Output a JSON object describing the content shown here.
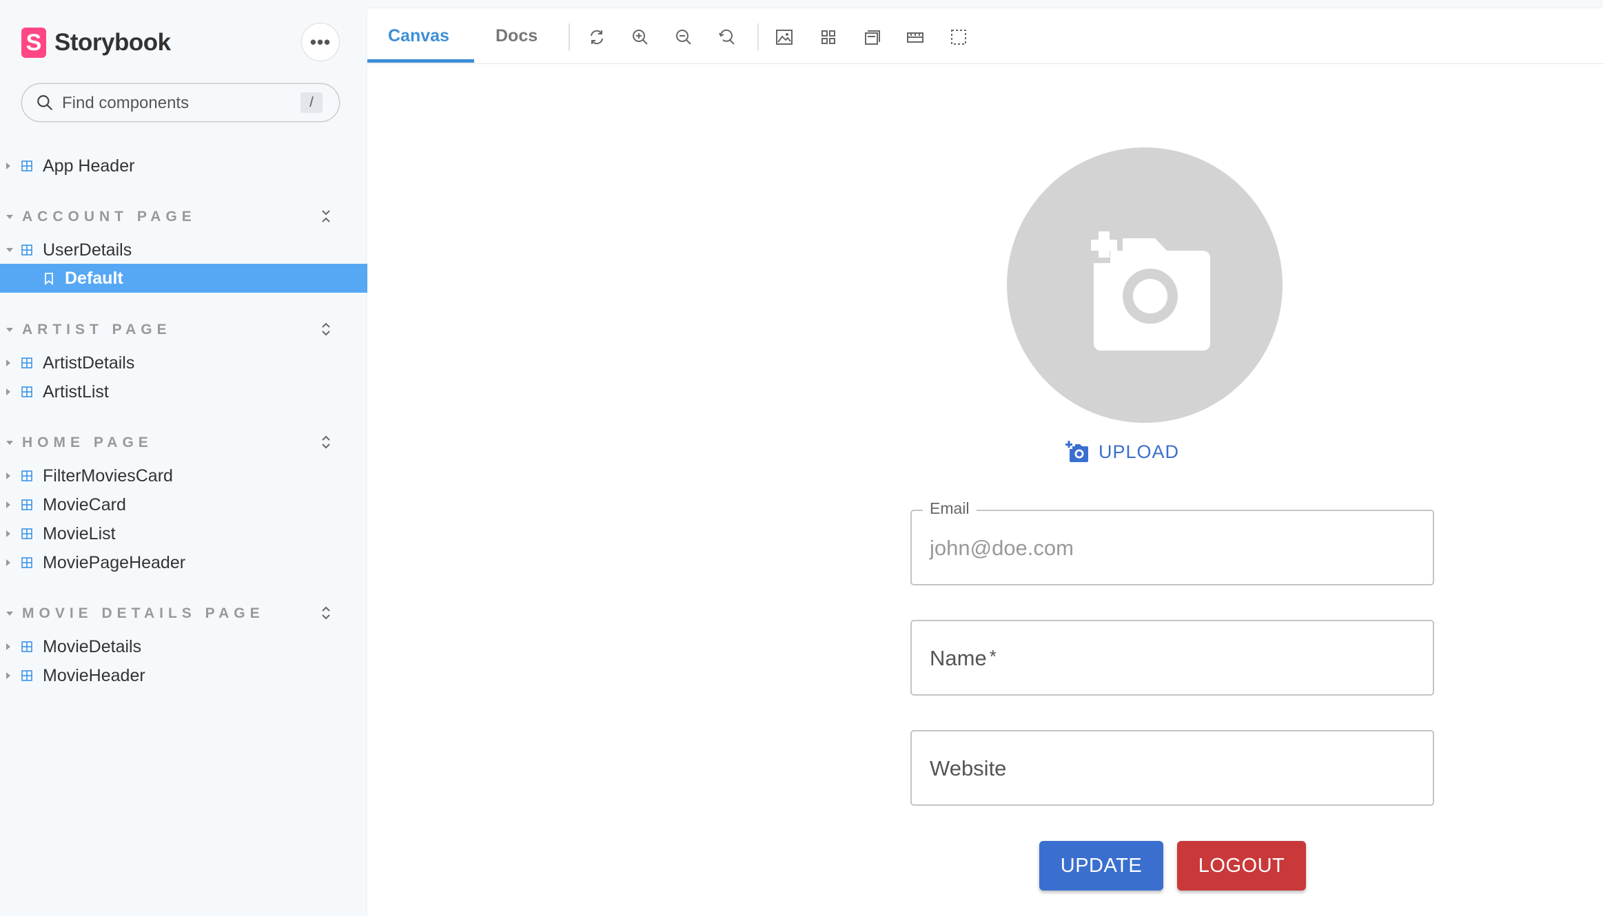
{
  "brand": {
    "name": "Storybook",
    "logo_letter": "S",
    "logo_color": "#ff4785"
  },
  "search": {
    "placeholder": "Find components",
    "shortcut": "/"
  },
  "sidebar": {
    "top_items": [
      {
        "label": "App Header"
      }
    ],
    "groups": [
      {
        "title": "ACCOUNT PAGE",
        "components": [
          {
            "label": "UserDetails",
            "stories": [
              {
                "label": "Default",
                "selected": true
              }
            ]
          }
        ]
      },
      {
        "title": "ARTIST PAGE",
        "components": [
          {
            "label": "ArtistDetails"
          },
          {
            "label": "ArtistList"
          }
        ]
      },
      {
        "title": "HOME PAGE",
        "components": [
          {
            "label": "FilterMoviesCard"
          },
          {
            "label": "MovieCard"
          },
          {
            "label": "MovieList"
          },
          {
            "label": "MoviePageHeader"
          }
        ]
      },
      {
        "title": "MOVIE DETAILS PAGE",
        "components": [
          {
            "label": "MovieDetails"
          },
          {
            "label": "MovieHeader"
          }
        ]
      }
    ]
  },
  "toolbar": {
    "tabs": [
      {
        "label": "Canvas",
        "active": true
      },
      {
        "label": "Docs",
        "active": false
      }
    ],
    "tools": [
      "reload-icon",
      "zoom-in-icon",
      "zoom-out-icon",
      "zoom-reset-icon",
      "background-icon",
      "grid-icon",
      "viewport-icon",
      "measure-icon",
      "outline-icon"
    ]
  },
  "canvas": {
    "upload_label": "UPLOAD",
    "email": {
      "label": "Email",
      "value": "john@doe.com"
    },
    "name": {
      "placeholder": "Name",
      "required_mark": "*"
    },
    "website": {
      "placeholder": "Website"
    },
    "update_label": "UPDATE",
    "logout_label": "LOGOUT"
  },
  "colors": {
    "primary": "#3a6fcf",
    "danger": "#c9393a",
    "selection": "#56a8f5",
    "tab_active": "#3e8ed8"
  }
}
